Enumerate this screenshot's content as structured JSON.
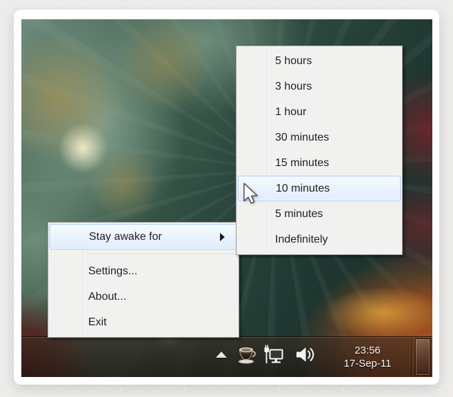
{
  "context_menu": {
    "items": [
      {
        "label": "Stay awake for",
        "has_submenu": true,
        "state": "highlighted"
      },
      {
        "label": "Settings...",
        "has_submenu": false,
        "state": "normal"
      },
      {
        "label": "About...",
        "has_submenu": false,
        "state": "normal"
      },
      {
        "label": "Exit",
        "has_submenu": false,
        "state": "normal"
      }
    ]
  },
  "submenu": {
    "parent": "Stay awake for",
    "highlighted_item": "10 minutes",
    "items": [
      {
        "label": "5 hours"
      },
      {
        "label": "3 hours"
      },
      {
        "label": "1 hour"
      },
      {
        "label": "30 minutes"
      },
      {
        "label": "15 minutes"
      },
      {
        "label": "10 minutes"
      },
      {
        "label": "5 minutes"
      },
      {
        "label": "Indefinitely"
      }
    ]
  },
  "taskbar": {
    "time": "23:56",
    "date": "17-Sep-11",
    "tray_icons": [
      "show-hidden-icons",
      "caffeine-coffee-cup",
      "network",
      "volume"
    ],
    "show_desktop_button": true
  },
  "colors": {
    "menu-bg": "#f1f1f0",
    "menu-border": "#9a9a9a",
    "menu-text": "#1e1e1e",
    "gutter-line": "#e2e3e3",
    "separator": "#d8d8d8",
    "highlight-border": "#a9cdf0",
    "highlight-top": "#f6fafe",
    "highlight-bottom": "#e1eefb",
    "clock-text": "#f7f4f1",
    "wp-teal-dark": "#1d332e",
    "wp-teal": "#41604f",
    "wp-sage": "#8fac99",
    "wp-cream": "#efe8c4",
    "wp-gold": "#b3924a",
    "wp-maroon": "#55201b",
    "wp-red": "#70242a",
    "wp-orange": "#a64f1e"
  }
}
